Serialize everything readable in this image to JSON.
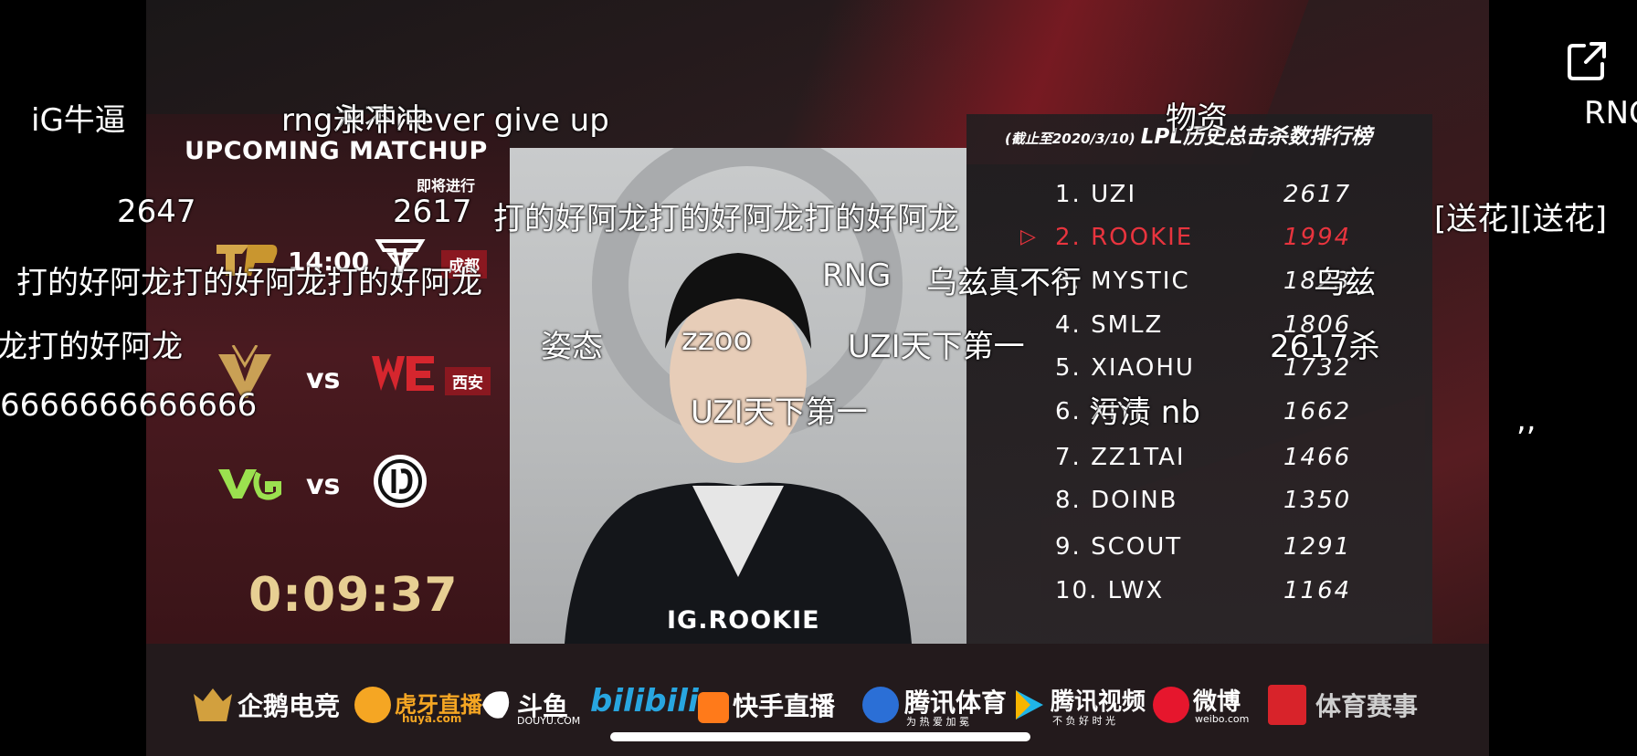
{
  "matchup": {
    "title": "UPCOMING MATCHUP",
    "subtitle": "即将进行",
    "row1": {
      "time": "14:00",
      "city": "成都"
    },
    "row2": {
      "vs": "vs",
      "city_badge": "西安"
    },
    "row3": {
      "vs": "vs"
    },
    "countdown": "0:09:37"
  },
  "photo": {
    "player_name": "IG.ROOKIE"
  },
  "ranking": {
    "date_note": "(截止至2020/3/10)",
    "title": "LPL历史总击杀数排行榜",
    "rows": [
      {
        "name": "1. UZI",
        "score": "2617"
      },
      {
        "name": "2. ROOKIE",
        "score": "1994",
        "highlight": true,
        "marker": "▷"
      },
      {
        "name": "3. MYSTIC",
        "score": "1823"
      },
      {
        "name": "4. SMLZ",
        "score": "1806"
      },
      {
        "name": "5. XIAOHU",
        "score": "1732"
      },
      {
        "name": "6. XIYE",
        "score": "1662"
      },
      {
        "name": "7. ZZ1TAI",
        "score": "1466"
      },
      {
        "name": "8. DOINB",
        "score": "1350"
      },
      {
        "name": "9. SCOUT",
        "score": "1291"
      },
      {
        "name": "10. LWX",
        "score": "1164"
      }
    ]
  },
  "sponsors": [
    "企鹅电竞",
    "虎牙直播",
    "斗鱼",
    "bilibili",
    "快手直播",
    "腾讯体育",
    "腾讯视频",
    "微博",
    "体育赛事"
  ],
  "sponsor_subtexts": {
    "huya": "huya.com",
    "douyu": "DOUYU.COM",
    "tencent_sports": "为 热 爱 加 冕",
    "tencent_video": "不 负 好 时 光",
    "weibo": "weibo.com"
  },
  "danmaku": [
    "iG牛逼",
    "rng永不never give up",
    "冲冲冲",
    "物资",
    "RNG",
    "2647",
    "2617",
    "打的好阿龙打的好阿龙打的好阿龙",
    "[送花][送花]",
    "打的好阿龙打的好阿龙打的好阿龙",
    "RNG",
    "乌兹真不行",
    "乌兹",
    "龙打的好阿龙",
    "姿态",
    "zzoo",
    "UZI天下第一",
    "2617杀",
    "6666666666666",
    "UZI天下第一",
    "污渍 nb",
    ",,"
  ],
  "icons": {
    "share": "share-icon"
  }
}
